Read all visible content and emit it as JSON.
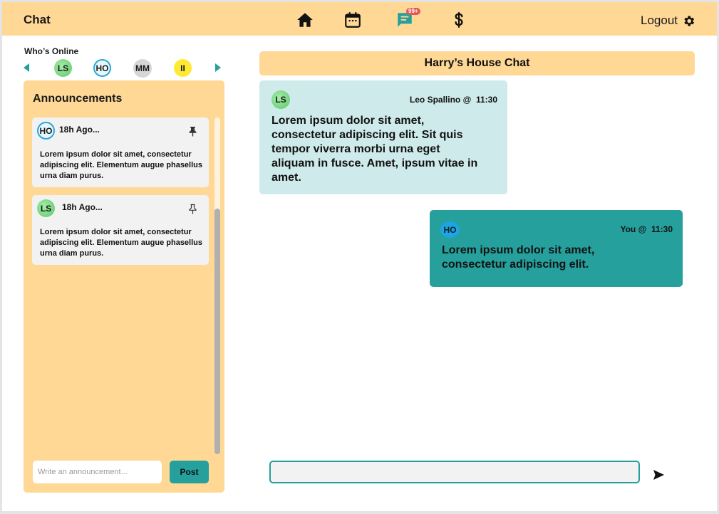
{
  "header": {
    "title": "Chat",
    "chat_badge": "99+",
    "logout_label": "Logout",
    "nav_icons": [
      "home-icon",
      "calendar-icon",
      "chat-icon",
      "dollar-icon"
    ],
    "accent_color": "#ffd896"
  },
  "online": {
    "title": "Who’s Online",
    "users": [
      {
        "initials": "LS",
        "color": "#6fd07b"
      },
      {
        "initials": "HO",
        "color": "#29a8d8"
      },
      {
        "initials": "MM",
        "color": "#d6d6d6"
      },
      {
        "initials": "II",
        "color": "#ffea33"
      }
    ]
  },
  "announcements": {
    "title": "Announcements",
    "items": [
      {
        "initials": "HO",
        "time": "18h Ago...",
        "text": "Lorem ipsum dolor sit amet, consectetur adipiscing elit. Elementum augue phasellus urna diam purus.",
        "pinned": true
      },
      {
        "initials": "LS",
        "time": "18h Ago...",
        "text": "Lorem ipsum dolor sit amet, consectetur adipiscing elit. Elementum augue phasellus urna diam purus.",
        "pinned": false
      }
    ],
    "input_placeholder": "Write an announcement...",
    "post_label": "Post"
  },
  "chat": {
    "title": "Harry’s House Chat",
    "messages": [
      {
        "initials": "LS",
        "sender": "Leo Spallino @",
        "time": "11:30",
        "text": "Lorem ipsum dolor sit amet, consectetur adipiscing elit. Sit quis tempor viverra morbi urna eget aliquam in fusce. Amet, ipsum vitae in amet.",
        "color": "#cfeaea"
      },
      {
        "initials": "HO",
        "sender": "You @",
        "time": "11:30",
        "text": "Lorem ipsum dolor sit amet, consectetur adipiscing elit.",
        "color": "#25a09d"
      }
    ],
    "input_value": "",
    "send_icon": "send-icon"
  }
}
